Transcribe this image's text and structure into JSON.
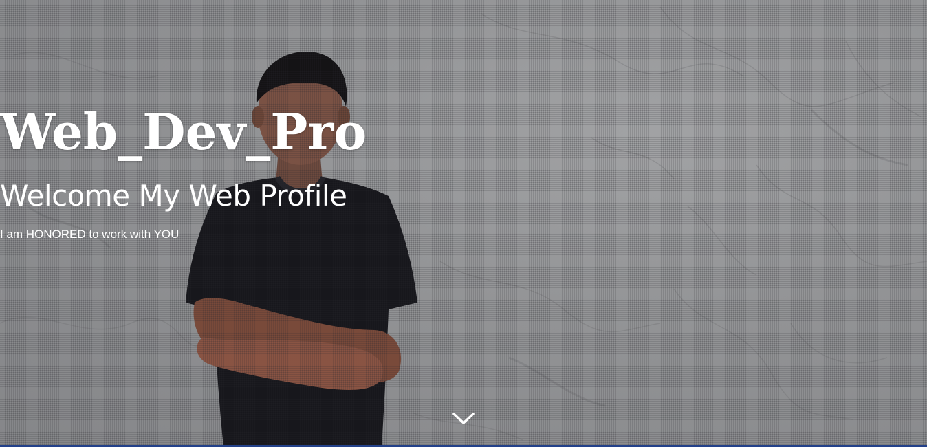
{
  "hero": {
    "title": "Web_Dev_Pro",
    "subtitle": "Welcome My Web Profile",
    "tagline": "I am HONORED to work with YOU",
    "scroll_icon": "chevron-down-icon"
  },
  "colors": {
    "background": "#8d8e90",
    "text": "#ffffff",
    "bottom_bar": "#23418a"
  }
}
